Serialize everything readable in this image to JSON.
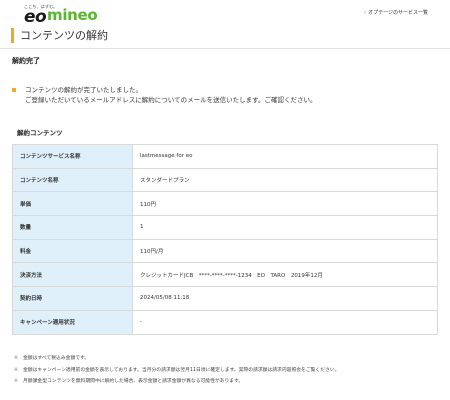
{
  "header": {
    "tagline": "ここち、はずむ。",
    "brand_eo": "eo",
    "brand_mineo": "mineo",
    "link_label": "オプテージのサービス一覧"
  },
  "page": {
    "title": "コンテンツの解約"
  },
  "status": {
    "heading": "解約完了",
    "message_line1": "コンテンツの解約が完了いたしました。",
    "message_line2": "ご登録いただいているメールアドレスに解約についてのメールを送信いたします。ご確認ください。"
  },
  "details": {
    "heading": "解約コンテンツ",
    "rows": [
      {
        "label": "コンテンツサービス名称",
        "value": "lastmessage for eo"
      },
      {
        "label": "コンテンツ名称",
        "value": "スタンダードプラン"
      },
      {
        "label": "単価",
        "value": "110円"
      },
      {
        "label": "数量",
        "value": "1"
      },
      {
        "label": "料金",
        "value": "110円/月"
      },
      {
        "label": "決済方法",
        "value": "クレジットカードJCB　****-****-****-1234　EO　TARO　2019年12月"
      },
      {
        "label": "契約日時",
        "value": "2024/05/08 11:18"
      },
      {
        "label": "キャンペーン適用状況",
        "value": "-"
      }
    ]
  },
  "notes": {
    "mark": "※",
    "items": [
      "金額はすべて税込み金額です。",
      "金額はキャンペーン適用前の金額を表示しております。当月分の請求額は翌月11日頃に確定します。実際の請求額は請求内容照会をご覧ください。",
      "月額課金型コンテンツを無料期間中に解約した場合、表示金額と請求金額が異なる可能性があります。"
    ]
  },
  "colors": {
    "accent_orange": "#f5a623",
    "mineo_green": "#5bb531",
    "table_label_bg": "#dff0fb"
  }
}
